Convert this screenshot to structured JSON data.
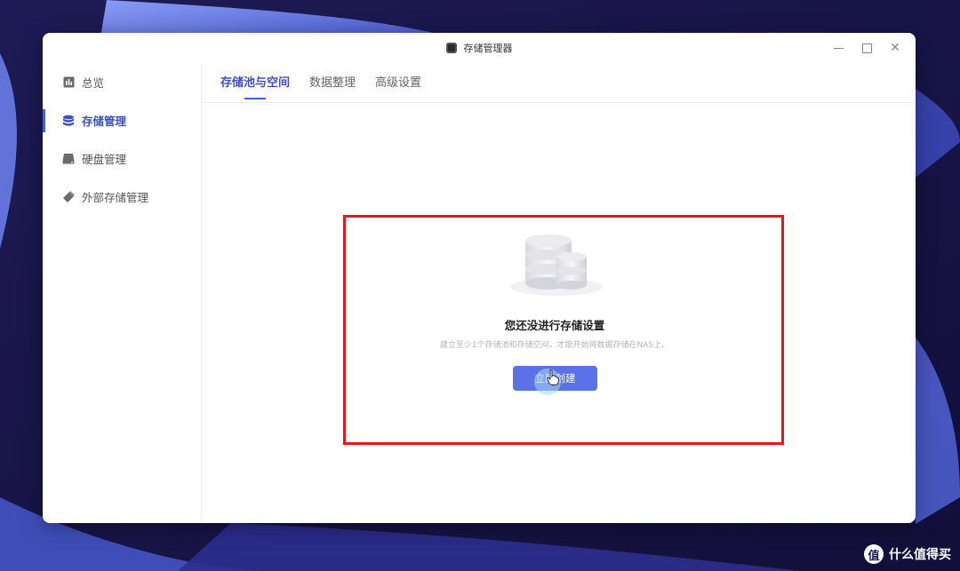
{
  "window": {
    "title": "存储管理器"
  },
  "sidebar": {
    "items": [
      {
        "label": "总览",
        "icon": "chart-icon",
        "active": false
      },
      {
        "label": "存储管理",
        "icon": "database-icon",
        "active": true
      },
      {
        "label": "硬盘管理",
        "icon": "disk-icon",
        "active": false
      },
      {
        "label": "外部存储管理",
        "icon": "usb-drive-icon",
        "active": false
      }
    ]
  },
  "tabs": [
    {
      "label": "存储池与空间",
      "active": true
    },
    {
      "label": "数据整理",
      "active": false
    },
    {
      "label": "高级设置",
      "active": false
    }
  ],
  "empty_state": {
    "title": "您还没进行存储设置",
    "description": "建立至少1个存储池和存储空间，才能开始将数据存储在NAS上。",
    "button_label": "立即创建"
  },
  "watermark": {
    "text": "什么值得买",
    "logo_char": "值"
  },
  "colors": {
    "accent": "#4a5fe0",
    "button": "#5b71e6",
    "highlight": "#e8141e"
  }
}
